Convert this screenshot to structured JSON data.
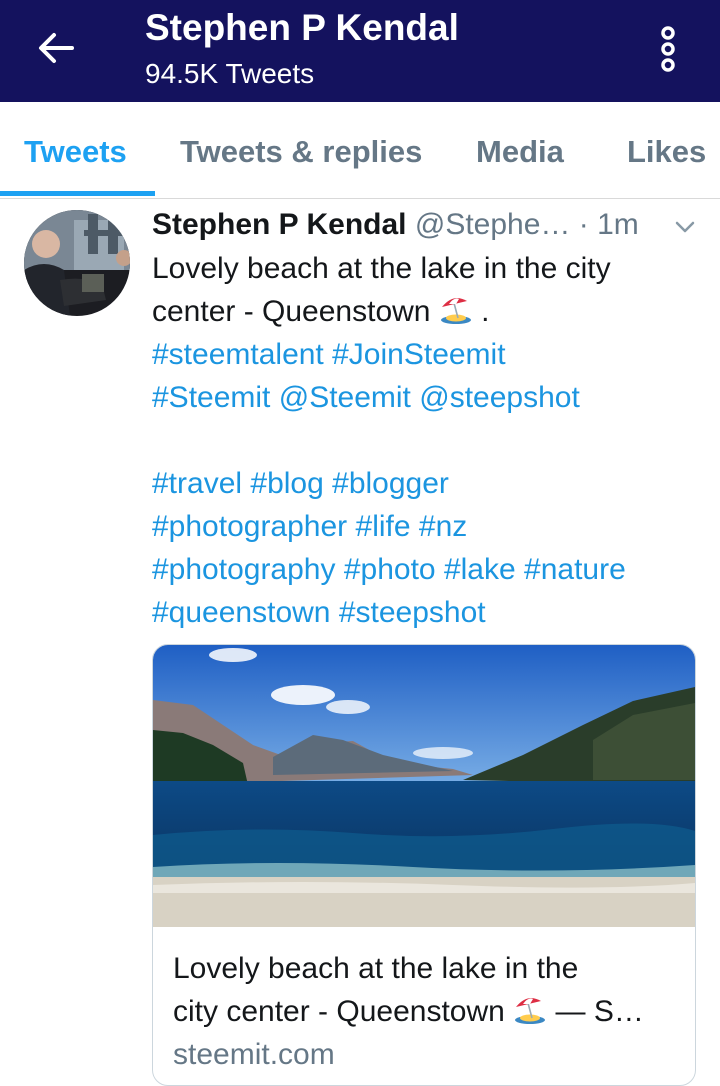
{
  "header": {
    "title": "Stephen P Kendal",
    "subtitle": "94.5K Tweets",
    "bg_color": "#14125e"
  },
  "tabs": [
    {
      "label": "Tweets",
      "active": true
    },
    {
      "label": "Tweets & replies",
      "active": false
    },
    {
      "label": "Media",
      "active": false
    },
    {
      "label": "Likes",
      "active": false
    }
  ],
  "accent_color": "#1da1f2",
  "tweet": {
    "author_name": "Stephen P Kendal",
    "author_handle": "@Stephe…",
    "separator": "·",
    "time": "1m",
    "text_line1": "Lovely beach at the lake in the city",
    "text_line2_a": "center - Queenstown",
    "text_line2_b": ".",
    "hashtags_line1": [
      "#steemtalent",
      "#JoinSteemit"
    ],
    "hashtags_line2": [
      "#Steemit",
      "@Steemit",
      "@steepshot"
    ],
    "hashtags_line3": [
      "#travel",
      "#blog",
      "#blogger"
    ],
    "hashtags_line4": [
      "#photographer",
      "#life",
      "#nz"
    ],
    "hashtags_line5": [
      "#photography",
      "#photo",
      "#lake",
      "#nature"
    ],
    "hashtags_line6": [
      "#queenstown",
      "#steepshot"
    ],
    "emoji_icon": "beach-umbrella-icon"
  },
  "card": {
    "title_line1": "Lovely beach at the lake in the",
    "title_line2_a": "city center - Queenstown",
    "title_line2_b": "— S…",
    "domain": "steemit.com"
  }
}
